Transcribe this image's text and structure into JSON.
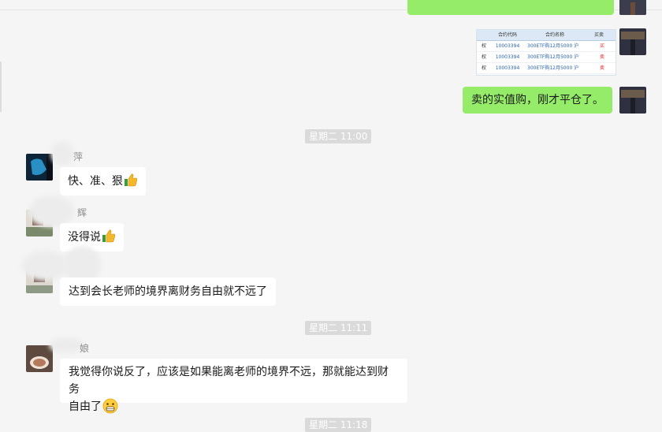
{
  "messages": {
    "m_sell": "卖的实值购，刚才平仓了。",
    "ts1": "星期二 11:00",
    "n1": "萍",
    "m1": "快、准、狠",
    "n2": "辉",
    "m2": "没得说",
    "m3": "达到会长老师的境界离财务自由就不远了",
    "ts2": "星期二 11:11",
    "n4": "娘",
    "m4_line1": "我觉得你说反了，应该是如果能离老师的境界不远，那就能达到财务",
    "m4_line2": "自由了",
    "ts3": "星期二 11:18"
  },
  "table_image": {
    "headers": [
      "合约代码",
      "合约名称",
      "买卖"
    ],
    "rows": [
      {
        "prefix": "权",
        "code": "10003394",
        "name": "300ETF购12月5000 沪",
        "side": "买"
      },
      {
        "prefix": "权",
        "code": "10003394",
        "name": "300ETF购12月5000 沪",
        "side": "卖"
      },
      {
        "prefix": "权",
        "code": "10003394",
        "name": "300ETF购12月5000 沪",
        "side": "卖"
      }
    ]
  },
  "colors": {
    "bg": "#f5f5f5",
    "bubble_right": "#95ec69",
    "bubble_left": "#ffffff",
    "timestamp_bg": "#dadada"
  },
  "icons": [
    "thumbs-up-icon",
    "grin-emoji-icon"
  ]
}
